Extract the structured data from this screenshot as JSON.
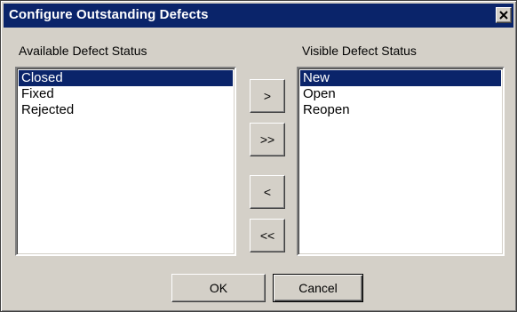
{
  "dialog": {
    "title": "Configure Outstanding Defects",
    "close_glyph": "✕"
  },
  "available": {
    "label": "Available Defect Status",
    "items": [
      "Closed",
      "Fixed",
      "Rejected"
    ],
    "selected_index": 0
  },
  "visible": {
    "label": "Visible Defect Status",
    "items": [
      "New",
      "Open",
      "Reopen"
    ],
    "selected_index": 0
  },
  "transfer_buttons": {
    "add_one": ">",
    "add_all": ">>",
    "remove_one": "<",
    "remove_all": "<<"
  },
  "footer": {
    "ok_label": "OK",
    "cancel_label": "Cancel"
  },
  "colors": {
    "title_bar": "#0a246a",
    "face": "#d4d0c8",
    "selection": "#0a246a"
  }
}
